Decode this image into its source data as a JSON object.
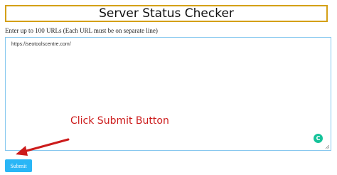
{
  "header": {
    "title": "Server Status Checker"
  },
  "form": {
    "instruction": "Enter up to 100 URLs (Each URL must be on separate line)",
    "url_value": "https://seotoolscentre.com/",
    "submit_label": "Submit"
  },
  "annotation": {
    "text": "Click Submit Button",
    "color": "#cc1b1b"
  },
  "icons": {
    "grammar": "grammarly-icon",
    "grammar_glyph": "C",
    "resize": "resize-handle-icon"
  },
  "colors": {
    "title_border": "#d4a017",
    "textarea_border": "#87c8ef",
    "button_bg": "#29b6f6",
    "grammar_bg": "#15c39a"
  }
}
